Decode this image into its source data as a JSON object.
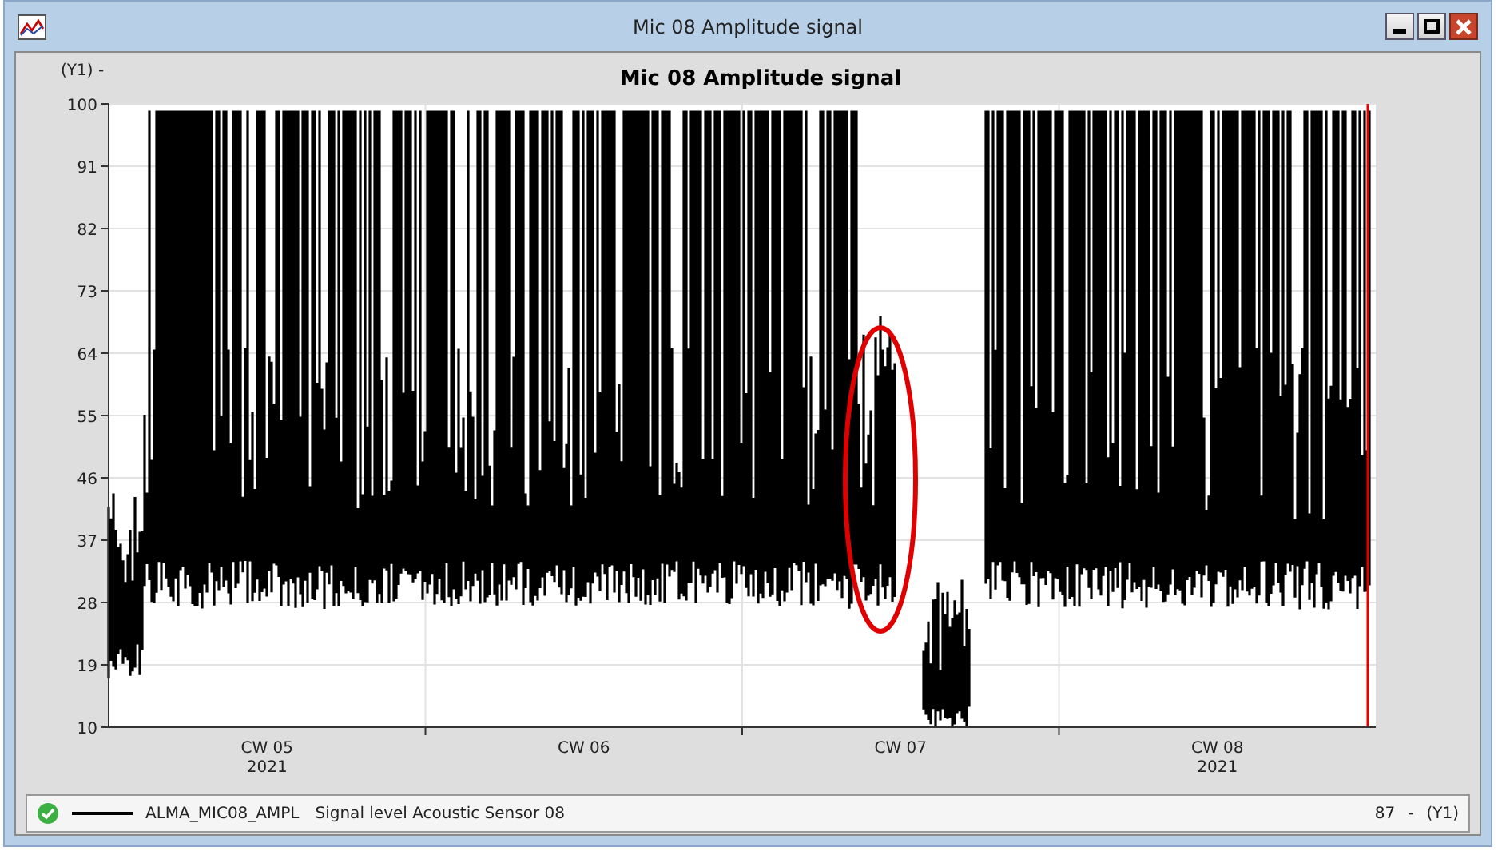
{
  "window": {
    "title": "Mic 08 Amplitude signal"
  },
  "chart": {
    "title": "Mic 08 Amplitude signal",
    "y_axis_label": "(Y1) -",
    "yticks": [
      "100",
      "91",
      "82",
      "73",
      "64",
      "55",
      "46",
      "37",
      "28",
      "19",
      "10"
    ],
    "xticks": [
      {
        "label": "CW 05",
        "sublabel": "2021"
      },
      {
        "label": "CW 06"
      },
      {
        "label": "CW 07"
      },
      {
        "label": "CW 08",
        "sublabel": "2021"
      }
    ]
  },
  "legend": {
    "name": "ALMA_MIC08_AMPL",
    "description": "Signal level Acoustic Sensor 08",
    "value": "87",
    "unit": "-",
    "axis": "(Y1)"
  }
}
